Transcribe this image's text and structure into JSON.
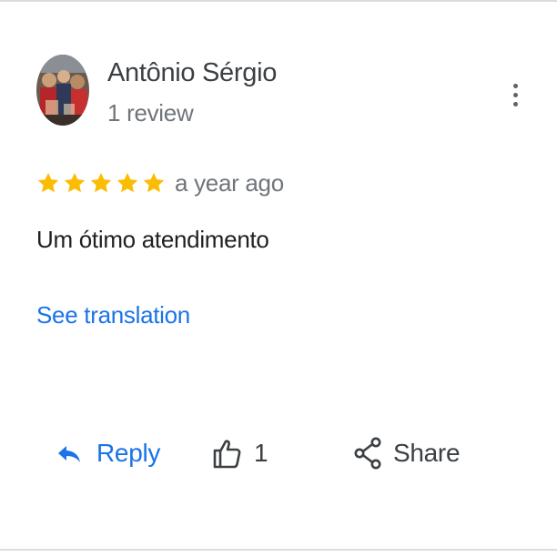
{
  "review": {
    "author_name": "Antônio Sérgio",
    "author_meta": "1 review",
    "rating": 5,
    "rating_max": 5,
    "time_ago": "a year ago",
    "text": "Um ótimo atendimento",
    "see_translation": "See translation"
  },
  "actions": {
    "reply_label": "Reply",
    "like_count": "1",
    "share_label": "Share"
  },
  "icons": {
    "more": "more-vert-icon",
    "star": "star-icon",
    "reply": "reply-icon",
    "like": "thumb-up-icon",
    "share": "share-icon"
  },
  "colors": {
    "star": "#fbbc04",
    "link": "#1a73e8",
    "primary_text": "#202124",
    "secondary_text": "#70757a",
    "icon": "#5f6368"
  }
}
